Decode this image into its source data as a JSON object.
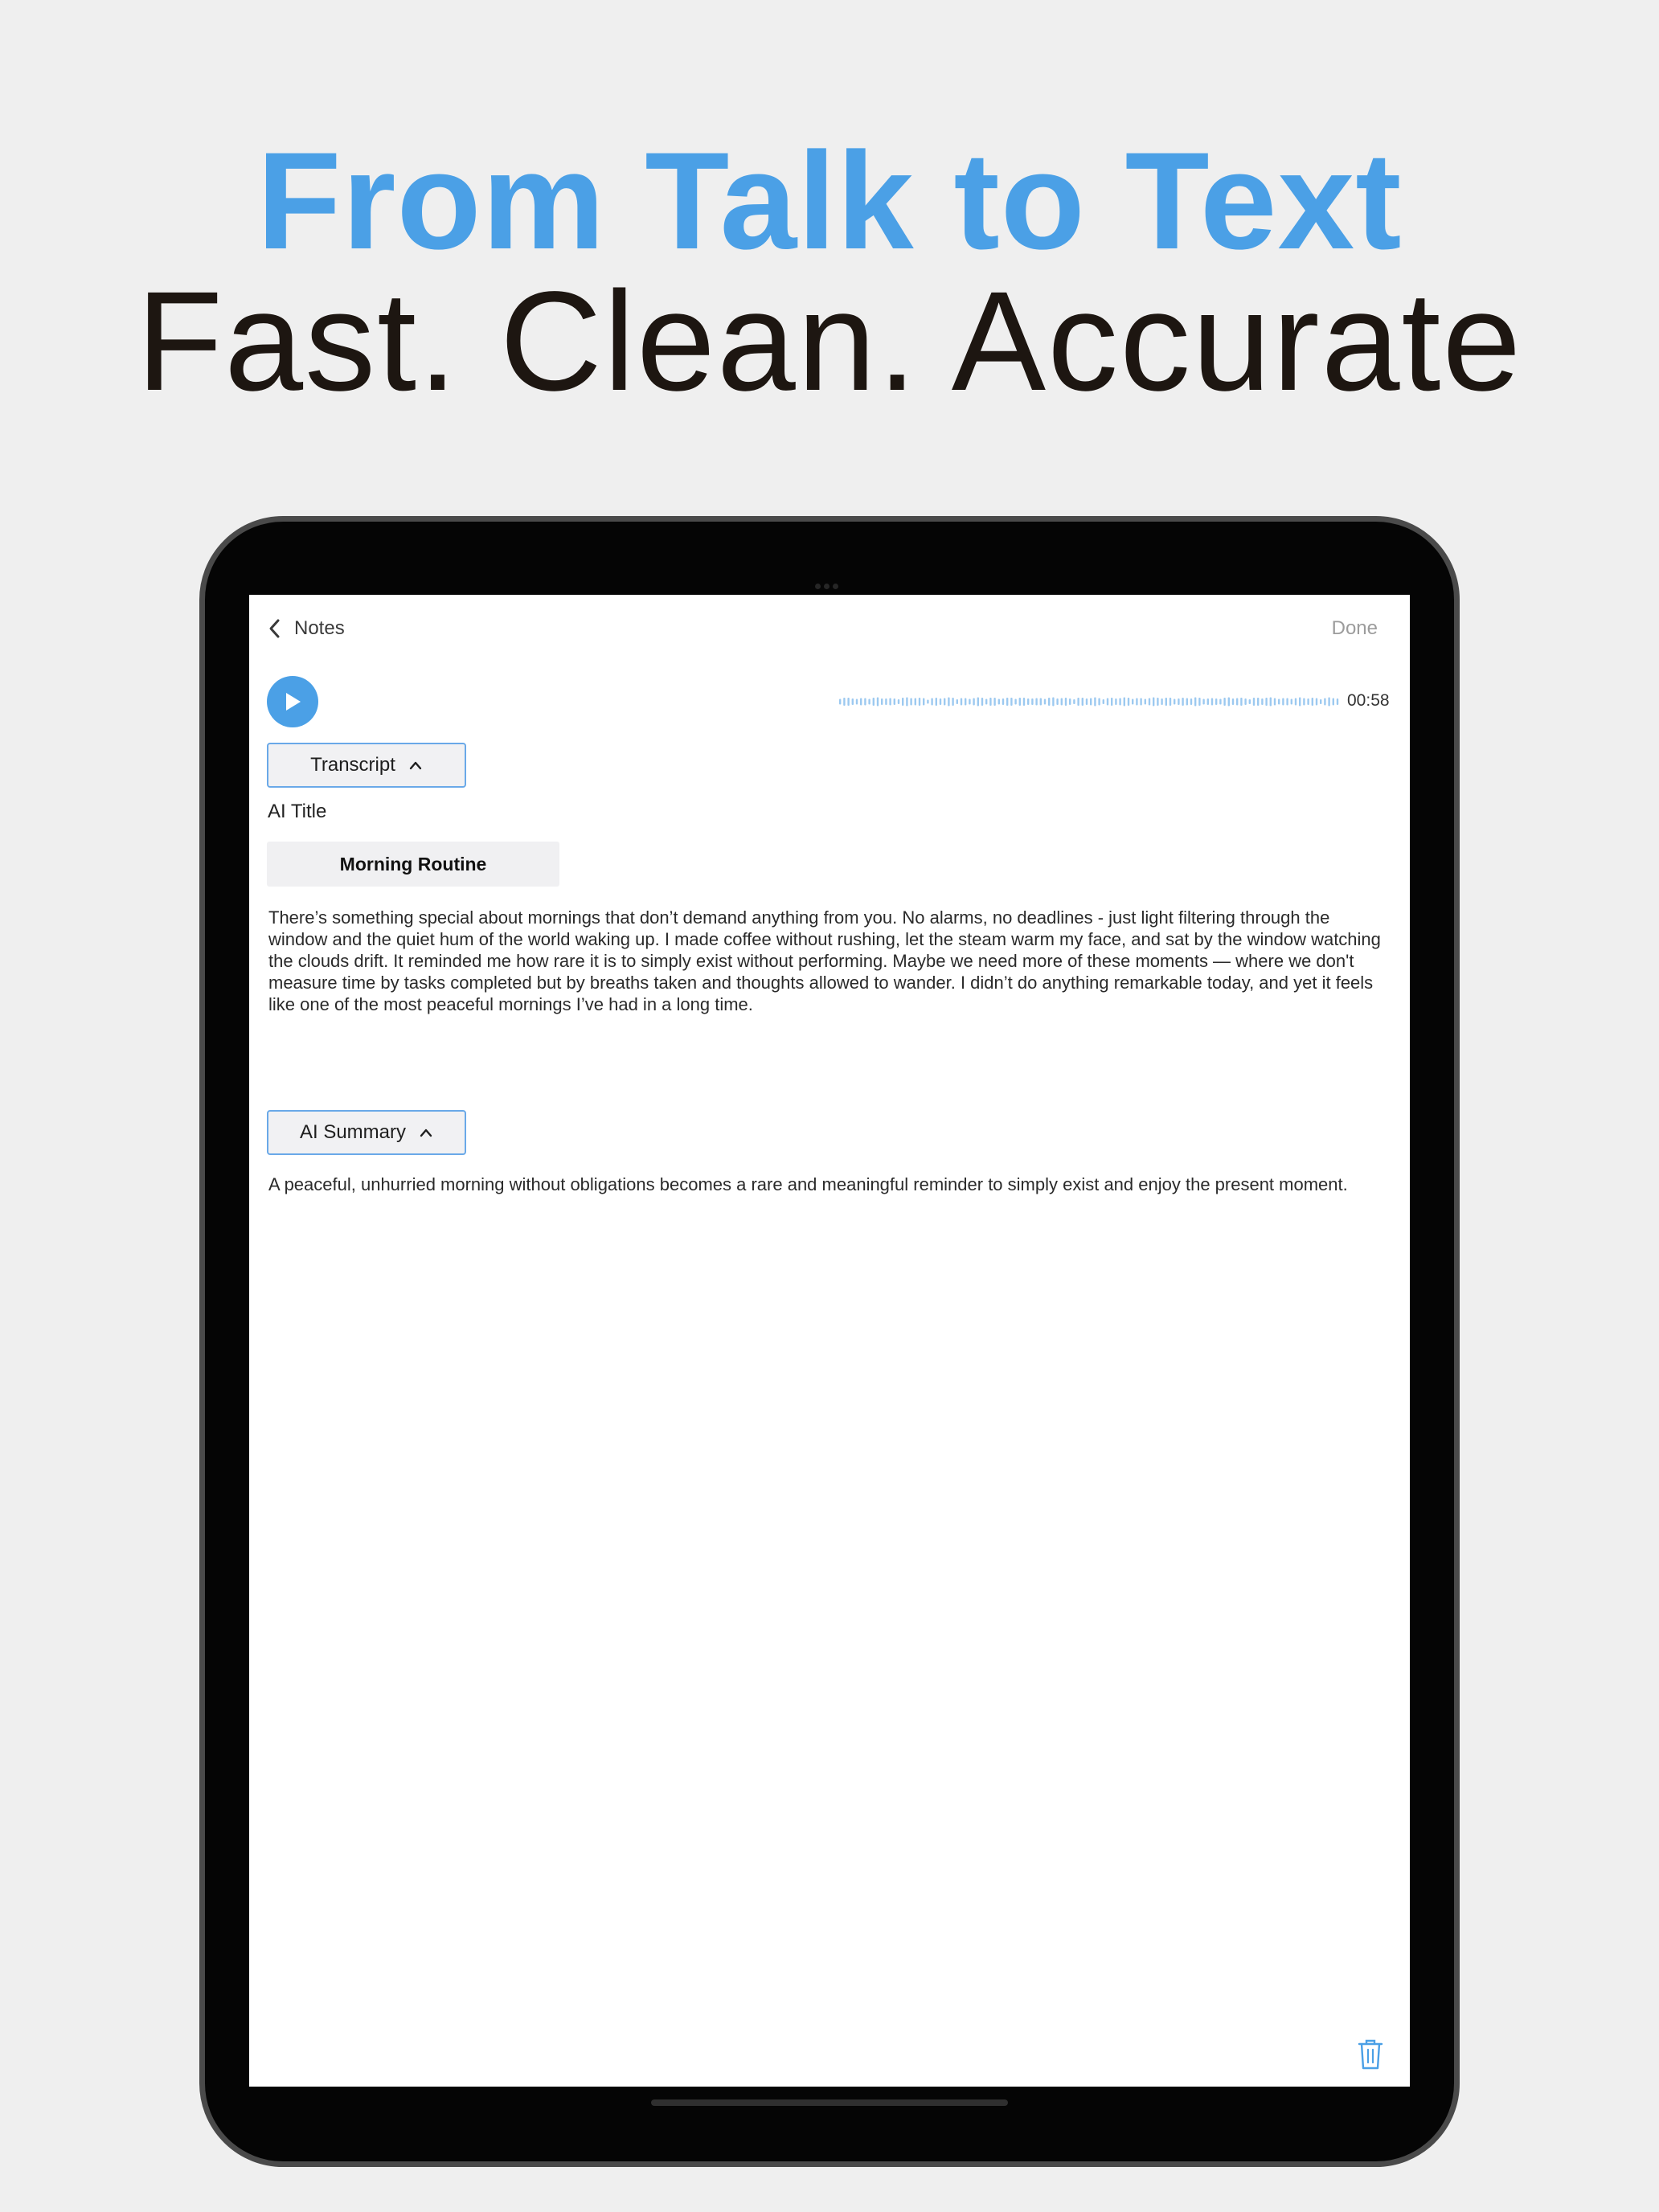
{
  "marketing": {
    "headline": "From Talk to Text",
    "subheadline": "Fast. Clean. Accurate"
  },
  "nav": {
    "back_label": "Notes",
    "done_label": "Done"
  },
  "player": {
    "duration": "00:58"
  },
  "transcript": {
    "toggle_label": "Transcript",
    "ai_title_label": "AI Title",
    "title_value": "Morning Routine",
    "text": "There’s something special about mornings that don’t demand anything from you. No alarms, no deadlines - just light filtering through the window and the quiet hum of the world waking up. I made coffee without rushing, let the steam warm my face, and sat by the window watching the clouds drift. It reminded me how rare it is to simply exist without performing. Maybe we need more of these moments — where we don't measure time by tasks completed but by breaths taken and thoughts allowed to wander. I didn’t do anything remarkable today, and yet it feels like one of the most peaceful mornings I’ve had in a long time."
  },
  "summary": {
    "toggle_label": "AI Summary",
    "text": "A peaceful, unhurried morning without obligations becomes a rare and meaningful reminder to simply exist and enjoy the present moment."
  },
  "colors": {
    "accent": "#4ba0e6",
    "headline_dark": "#1d1611",
    "background": "#efefef"
  },
  "icons": [
    "chevron-left-icon",
    "play-icon",
    "waveform",
    "chevron-up-icon",
    "trash-icon"
  ]
}
